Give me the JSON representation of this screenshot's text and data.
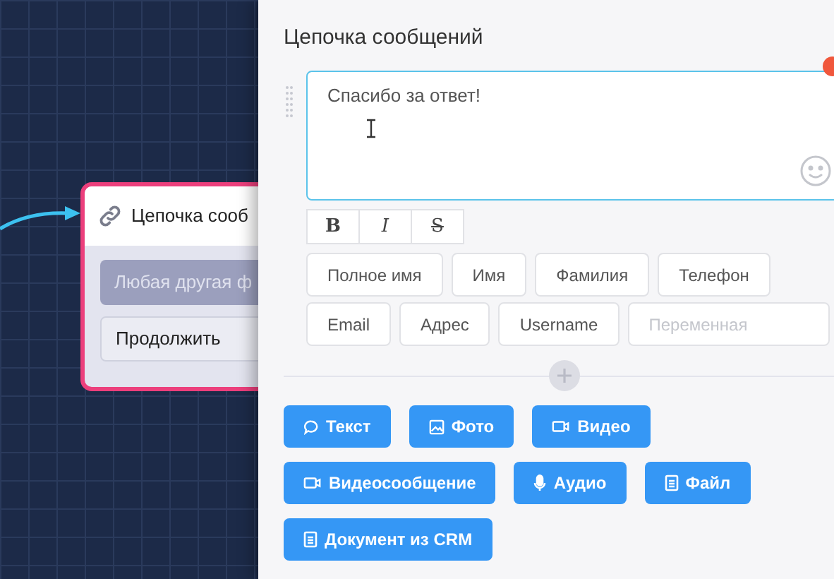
{
  "canvas": {
    "node": {
      "title": "Цепочка сооб",
      "selected": true,
      "buttons": [
        {
          "label": "Любая другая ф",
          "kind": "filled"
        },
        {
          "label": "Продолжить",
          "kind": "outline"
        }
      ]
    }
  },
  "panel": {
    "title": "Цепочка сообщений",
    "message": {
      "value": "Спасибо за ответ!"
    },
    "format_buttons": [
      {
        "label": "B",
        "kind": "bold"
      },
      {
        "label": "I",
        "kind": "italic"
      },
      {
        "label": "S",
        "kind": "strike"
      }
    ],
    "variable_rows": [
      [
        "Полное имя",
        "Имя",
        "Фамилия",
        "Телефон"
      ],
      [
        "Email",
        "Адрес",
        "Username"
      ]
    ],
    "variable_field": {
      "placeholder": "Переменная"
    },
    "add_button_rows": [
      [
        {
          "label": "Текст",
          "kind": "text"
        },
        {
          "label": "Фото",
          "kind": "photo"
        },
        {
          "label": "Видео",
          "kind": "video"
        }
      ],
      [
        {
          "label": "Видеосообщение",
          "kind": "video"
        },
        {
          "label": "Аудио",
          "kind": "audio"
        },
        {
          "label": "Файл",
          "kind": "file"
        }
      ],
      [
        {
          "label": "Документ из CRM",
          "kind": "file"
        }
      ]
    ]
  }
}
